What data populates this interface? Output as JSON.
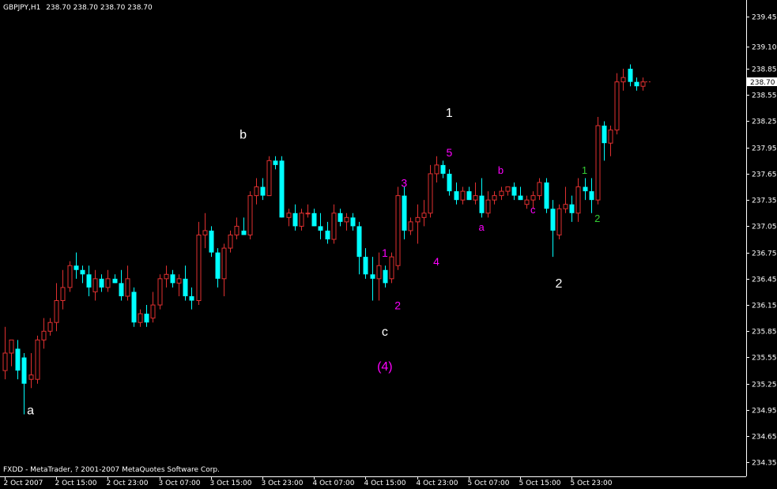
{
  "header": {
    "symbol": "GBPJPY,H1",
    "ohlc": "238.70 238.70 238.70 238.70"
  },
  "footer": {
    "copyright": "FXDD - MetaTrader, ? 2001-2007 MetaQuotes Software Corp."
  },
  "current_price": "238.70",
  "colors": {
    "background": "#000000",
    "bull": "#e03030",
    "bear": "#00ffff",
    "axis": "#ffffff",
    "magenta": "#ff00ff",
    "green": "#33cc33",
    "white": "#ffffff"
  },
  "chart_data": {
    "type": "candlestick",
    "title": "GBPJPY,H1",
    "ylim": [
      234.2,
      239.6
    ],
    "y_ticks": [
      "239.45",
      "239.10",
      "238.85",
      "238.55",
      "238.25",
      "237.95",
      "237.65",
      "237.35",
      "237.05",
      "236.75",
      "236.45",
      "236.15",
      "235.85",
      "235.55",
      "235.25",
      "234.95",
      "234.65",
      "234.35"
    ],
    "x_ticks": [
      "2 Oct 2007",
      "2 Oct 15:00",
      "2 Oct 23:00",
      "3 Oct 07:00",
      "3 Oct 15:00",
      "3 Oct 23:00",
      "4 Oct 07:00",
      "4 Oct 15:00",
      "4 Oct 23:00",
      "5 Oct 07:00",
      "5 Oct 15:00",
      "5 Oct 23:00"
    ],
    "bars_per_tick": 8,
    "candles": [
      {
        "o": 235.4,
        "h": 235.9,
        "l": 235.3,
        "c": 235.6
      },
      {
        "o": 235.6,
        "h": 235.75,
        "l": 235.45,
        "c": 235.75
      },
      {
        "o": 235.65,
        "h": 235.75,
        "l": 235.3,
        "c": 235.4
      },
      {
        "o": 235.55,
        "h": 235.6,
        "l": 234.9,
        "c": 235.25
      },
      {
        "o": 235.3,
        "h": 235.6,
        "l": 235.2,
        "c": 235.35
      },
      {
        "o": 235.3,
        "h": 235.8,
        "l": 235.25,
        "c": 235.75
      },
      {
        "o": 235.75,
        "h": 236.0,
        "l": 235.65,
        "c": 235.85
      },
      {
        "o": 235.85,
        "h": 236.0,
        "l": 235.8,
        "c": 235.95
      },
      {
        "o": 235.95,
        "h": 236.4,
        "l": 235.85,
        "c": 236.2
      },
      {
        "o": 236.2,
        "h": 236.55,
        "l": 236.1,
        "c": 236.35
      },
      {
        "o": 236.35,
        "h": 236.65,
        "l": 236.3,
        "c": 236.6
      },
      {
        "o": 236.6,
        "h": 236.75,
        "l": 236.45,
        "c": 236.55
      },
      {
        "o": 236.55,
        "h": 236.6,
        "l": 236.4,
        "c": 236.5
      },
      {
        "o": 236.5,
        "h": 236.6,
        "l": 236.25,
        "c": 236.35
      },
      {
        "o": 236.3,
        "h": 236.55,
        "l": 236.2,
        "c": 236.45
      },
      {
        "o": 236.45,
        "h": 236.5,
        "l": 236.3,
        "c": 236.35
      },
      {
        "o": 236.35,
        "h": 236.55,
        "l": 236.3,
        "c": 236.45
      },
      {
        "o": 236.45,
        "h": 236.5,
        "l": 236.4,
        "c": 236.4
      },
      {
        "o": 236.4,
        "h": 236.55,
        "l": 236.2,
        "c": 236.25
      },
      {
        "o": 236.25,
        "h": 236.6,
        "l": 236.2,
        "c": 236.45
      },
      {
        "o": 236.3,
        "h": 236.35,
        "l": 235.9,
        "c": 235.95
      },
      {
        "o": 235.95,
        "h": 236.1,
        "l": 235.9,
        "c": 236.05
      },
      {
        "o": 236.05,
        "h": 236.15,
        "l": 235.9,
        "c": 235.95
      },
      {
        "o": 236.0,
        "h": 236.3,
        "l": 235.95,
        "c": 236.15
      },
      {
        "o": 236.15,
        "h": 236.5,
        "l": 236.1,
        "c": 236.45
      },
      {
        "o": 236.45,
        "h": 236.6,
        "l": 236.35,
        "c": 236.5
      },
      {
        "o": 236.5,
        "h": 236.55,
        "l": 236.35,
        "c": 236.4
      },
      {
        "o": 236.4,
        "h": 236.5,
        "l": 236.25,
        "c": 236.45
      },
      {
        "o": 236.45,
        "h": 236.6,
        "l": 236.2,
        "c": 236.25
      },
      {
        "o": 236.25,
        "h": 236.35,
        "l": 236.1,
        "c": 236.2
      },
      {
        "o": 236.2,
        "h": 237.1,
        "l": 236.15,
        "c": 236.95
      },
      {
        "o": 236.95,
        "h": 237.2,
        "l": 236.8,
        "c": 237.0
      },
      {
        "o": 237.0,
        "h": 237.05,
        "l": 236.7,
        "c": 236.75
      },
      {
        "o": 236.75,
        "h": 236.8,
        "l": 236.35,
        "c": 236.45
      },
      {
        "o": 236.45,
        "h": 236.85,
        "l": 236.25,
        "c": 236.8
      },
      {
        "o": 236.8,
        "h": 237.0,
        "l": 236.75,
        "c": 236.95
      },
      {
        "o": 236.95,
        "h": 237.15,
        "l": 236.9,
        "c": 237.05
      },
      {
        "o": 237.0,
        "h": 237.15,
        "l": 236.95,
        "c": 236.95
      },
      {
        "o": 236.95,
        "h": 237.45,
        "l": 236.9,
        "c": 237.4
      },
      {
        "o": 237.4,
        "h": 237.6,
        "l": 237.3,
        "c": 237.5
      },
      {
        "o": 237.5,
        "h": 237.6,
        "l": 237.35,
        "c": 237.4
      },
      {
        "o": 237.4,
        "h": 237.85,
        "l": 237.4,
        "c": 237.8
      },
      {
        "o": 237.8,
        "h": 237.85,
        "l": 237.7,
        "c": 237.75
      },
      {
        "o": 237.8,
        "h": 237.85,
        "l": 237.15,
        "c": 237.15
      },
      {
        "o": 237.15,
        "h": 237.25,
        "l": 237.05,
        "c": 237.2
      },
      {
        "o": 237.2,
        "h": 237.3,
        "l": 237.0,
        "c": 237.05
      },
      {
        "o": 237.05,
        "h": 237.25,
        "l": 237.0,
        "c": 237.2
      },
      {
        "o": 237.2,
        "h": 237.3,
        "l": 237.15,
        "c": 237.2
      },
      {
        "o": 237.2,
        "h": 237.25,
        "l": 237.05,
        "c": 237.05
      },
      {
        "o": 237.05,
        "h": 237.2,
        "l": 236.9,
        "c": 237.0
      },
      {
        "o": 237.0,
        "h": 237.1,
        "l": 236.85,
        "c": 236.9
      },
      {
        "o": 236.9,
        "h": 237.3,
        "l": 236.85,
        "c": 237.2
      },
      {
        "o": 237.2,
        "h": 237.25,
        "l": 237.05,
        "c": 237.1
      },
      {
        "o": 237.1,
        "h": 237.2,
        "l": 237.0,
        "c": 237.15
      },
      {
        "o": 237.15,
        "h": 237.2,
        "l": 237.0,
        "c": 237.05
      },
      {
        "o": 237.05,
        "h": 237.1,
        "l": 236.5,
        "c": 236.7
      },
      {
        "o": 236.7,
        "h": 236.8,
        "l": 236.45,
        "c": 236.5
      },
      {
        "o": 236.5,
        "h": 236.7,
        "l": 236.2,
        "c": 236.45
      },
      {
        "o": 236.45,
        "h": 236.75,
        "l": 236.2,
        "c": 236.6
      },
      {
        "o": 236.55,
        "h": 236.6,
        "l": 236.35,
        "c": 236.4
      },
      {
        "o": 236.45,
        "h": 236.75,
        "l": 236.4,
        "c": 236.7
      },
      {
        "o": 236.6,
        "h": 237.5,
        "l": 236.55,
        "c": 237.4
      },
      {
        "o": 237.4,
        "h": 237.5,
        "l": 236.9,
        "c": 237.0
      },
      {
        "o": 237.0,
        "h": 237.15,
        "l": 236.95,
        "c": 237.1
      },
      {
        "o": 237.1,
        "h": 237.3,
        "l": 236.85,
        "c": 237.15
      },
      {
        "o": 237.15,
        "h": 237.35,
        "l": 237.05,
        "c": 237.2
      },
      {
        "o": 237.2,
        "h": 237.75,
        "l": 237.15,
        "c": 237.65
      },
      {
        "o": 237.65,
        "h": 237.85,
        "l": 237.55,
        "c": 237.75
      },
      {
        "o": 237.75,
        "h": 237.8,
        "l": 237.6,
        "c": 237.65
      },
      {
        "o": 237.65,
        "h": 237.7,
        "l": 237.4,
        "c": 237.45
      },
      {
        "o": 237.45,
        "h": 237.55,
        "l": 237.3,
        "c": 237.35
      },
      {
        "o": 237.35,
        "h": 237.5,
        "l": 237.3,
        "c": 237.45
      },
      {
        "o": 237.45,
        "h": 237.5,
        "l": 237.35,
        "c": 237.35
      },
      {
        "o": 237.35,
        "h": 237.55,
        "l": 237.3,
        "c": 237.4
      },
      {
        "o": 237.4,
        "h": 237.6,
        "l": 237.15,
        "c": 237.2
      },
      {
        "o": 237.2,
        "h": 237.45,
        "l": 237.15,
        "c": 237.35
      },
      {
        "o": 237.35,
        "h": 237.45,
        "l": 237.3,
        "c": 237.4
      },
      {
        "o": 237.4,
        "h": 237.5,
        "l": 237.35,
        "c": 237.45
      },
      {
        "o": 237.45,
        "h": 237.5,
        "l": 237.4,
        "c": 237.5
      },
      {
        "o": 237.5,
        "h": 237.55,
        "l": 237.35,
        "c": 237.4
      },
      {
        "o": 237.4,
        "h": 237.5,
        "l": 237.35,
        "c": 237.35
      },
      {
        "o": 237.3,
        "h": 237.4,
        "l": 237.25,
        "c": 237.35
      },
      {
        "o": 237.35,
        "h": 237.45,
        "l": 237.25,
        "c": 237.4
      },
      {
        "o": 237.4,
        "h": 237.6,
        "l": 237.35,
        "c": 237.55
      },
      {
        "o": 237.55,
        "h": 237.6,
        "l": 237.2,
        "c": 237.25
      },
      {
        "o": 237.25,
        "h": 237.35,
        "l": 236.7,
        "c": 237.0
      },
      {
        "o": 236.95,
        "h": 237.3,
        "l": 236.9,
        "c": 237.25
      },
      {
        "o": 237.25,
        "h": 237.5,
        "l": 237.2,
        "c": 237.3
      },
      {
        "o": 237.3,
        "h": 237.4,
        "l": 237.1,
        "c": 237.2
      },
      {
        "o": 237.2,
        "h": 237.6,
        "l": 237.1,
        "c": 237.5
      },
      {
        "o": 237.5,
        "h": 237.6,
        "l": 237.35,
        "c": 237.45
      },
      {
        "o": 237.45,
        "h": 237.6,
        "l": 237.2,
        "c": 237.35
      },
      {
        "o": 237.35,
        "h": 238.3,
        "l": 237.3,
        "c": 238.2
      },
      {
        "o": 238.2,
        "h": 238.25,
        "l": 237.8,
        "c": 238.0
      },
      {
        "o": 238.0,
        "h": 238.2,
        "l": 237.85,
        "c": 238.15
      },
      {
        "o": 238.15,
        "h": 238.8,
        "l": 238.1,
        "c": 238.7
      },
      {
        "o": 238.7,
        "h": 238.85,
        "l": 238.6,
        "c": 238.75
      },
      {
        "o": 238.85,
        "h": 238.9,
        "l": 238.65,
        "c": 238.7
      },
      {
        "o": 238.7,
        "h": 238.75,
        "l": 238.6,
        "c": 238.65
      },
      {
        "o": 238.65,
        "h": 238.75,
        "l": 238.6,
        "c": 238.7
      }
    ],
    "annotations": [
      {
        "text": "a",
        "color": "#ffffff",
        "x": 4,
        "price": 234.9,
        "size": 16
      },
      {
        "text": "b",
        "color": "#ffffff",
        "x": 37,
        "price": 238.05,
        "size": 16
      },
      {
        "text": "c",
        "color": "#ffffff",
        "x": 59,
        "price": 235.8,
        "size": 16
      },
      {
        "text": "(4)",
        "color": "#ff00ff",
        "x": 59,
        "price": 235.4,
        "size": 16
      },
      {
        "text": "1",
        "color": "#ffffff",
        "x": 69,
        "price": 238.3,
        "size": 16
      },
      {
        "text": "2",
        "color": "#ffffff",
        "x": 86,
        "price": 236.35,
        "size": 16
      },
      {
        "text": "1",
        "color": "#ff00ff",
        "x": 59,
        "price": 236.7,
        "size": 14
      },
      {
        "text": "2",
        "color": "#ff00ff",
        "x": 61,
        "price": 236.1,
        "size": 14
      },
      {
        "text": "3",
        "color": "#ff00ff",
        "x": 62,
        "price": 237.5,
        "size": 14
      },
      {
        "text": "4",
        "color": "#ff00ff",
        "x": 67,
        "price": 236.6,
        "size": 14
      },
      {
        "text": "5",
        "color": "#ff00ff",
        "x": 69,
        "price": 237.85,
        "size": 14
      },
      {
        "text": "a",
        "color": "#ff00ff",
        "x": 74,
        "price": 237.0,
        "size": 13
      },
      {
        "text": "b",
        "color": "#ff00ff",
        "x": 77,
        "price": 237.65,
        "size": 13
      },
      {
        "text": "c",
        "color": "#ff00ff",
        "x": 82,
        "price": 237.2,
        "size": 13
      },
      {
        "text": "1",
        "color": "#33cc33",
        "x": 90,
        "price": 237.65,
        "size": 13
      },
      {
        "text": "2",
        "color": "#33cc33",
        "x": 92,
        "price": 237.1,
        "size": 13
      }
    ]
  }
}
